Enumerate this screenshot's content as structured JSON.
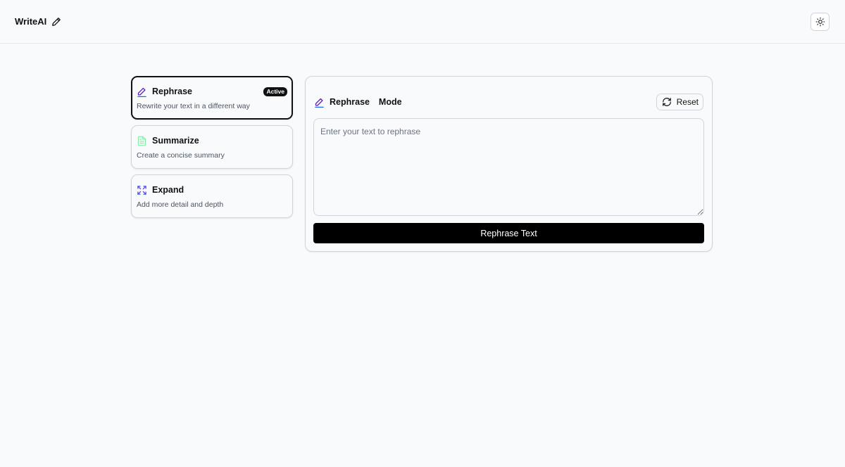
{
  "header": {
    "brand_name": "WriteAI",
    "brand_icon": "pencil-icon",
    "theme_icon": "sun-icon"
  },
  "modes": [
    {
      "title": "Rephrase",
      "description": "Rewrite your text in a different way",
      "icon": "pencil-icon",
      "active": true,
      "badge": "Active"
    },
    {
      "title": "Summarize",
      "description": "Create a concise summary",
      "icon": "document-icon",
      "active": false
    },
    {
      "title": "Expand",
      "description": "Add more detail and depth",
      "icon": "expand-icon",
      "active": false
    }
  ],
  "panel": {
    "title": "Rephrase  Mode",
    "reset_label": "Reset",
    "input_placeholder": "Enter your text to rephrase",
    "input_value": "",
    "submit_label": "Rephrase Text"
  },
  "colors": {
    "accent_purple": "#5b21b6",
    "accent_blue": "#2563eb",
    "summarize_green": "#86efac",
    "primary_button": "#000000"
  }
}
